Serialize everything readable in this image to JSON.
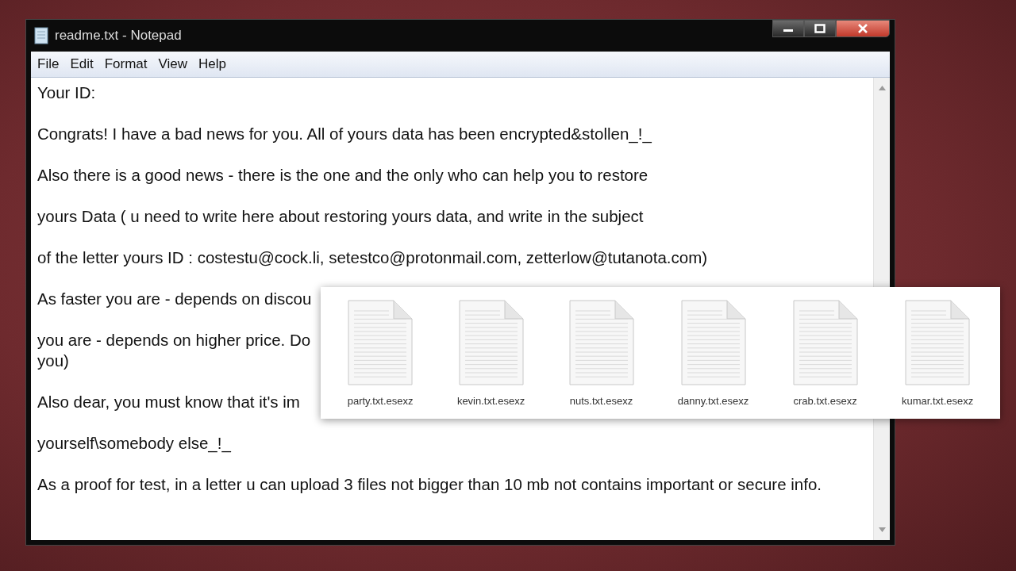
{
  "window": {
    "title": "readme.txt - Notepad"
  },
  "menu": [
    "File",
    "Edit",
    "Format",
    "View",
    "Help"
  ],
  "paragraphs": [
    {
      "lines": [
        "Your ID:"
      ]
    },
    {
      "lines": [
        "Congrats! I have a bad news for you. All of yours data has been encrypted&stollen_!_"
      ]
    },
    {
      "lines": [
        "Also there is a good news - there is the one and the only who can help you to restore"
      ]
    },
    {
      "lines": [
        "yours Data ( u need to write here about restoring yours data, and write in the subject"
      ]
    },
    {
      "lines": [
        "of the letter yours ID : costestu@cock.li, setestco@protonmail.com, zetterlow@tutanota.com)"
      ]
    },
    {
      "lines": [
        "As faster you are - depends on discou"
      ]
    },
    {
      "lines": [
        "you are - depends on higher price. Do",
        "you)"
      ]
    },
    {
      "lines": [
        "Also dear, you must know that it's im"
      ]
    },
    {
      "lines": [
        "yourself\\somebody else_!_"
      ]
    },
    {
      "lines": [
        "As a proof for test, in a letter  u can upload 3 files not bigger than 10 mb not contains important or secure info."
      ]
    }
  ],
  "files": [
    "party.txt.esexz",
    "kevin.txt.esexz",
    "nuts.txt.esexz",
    "danny.txt.esexz",
    "crab.txt.esexz",
    "kumar.txt.esexz"
  ]
}
